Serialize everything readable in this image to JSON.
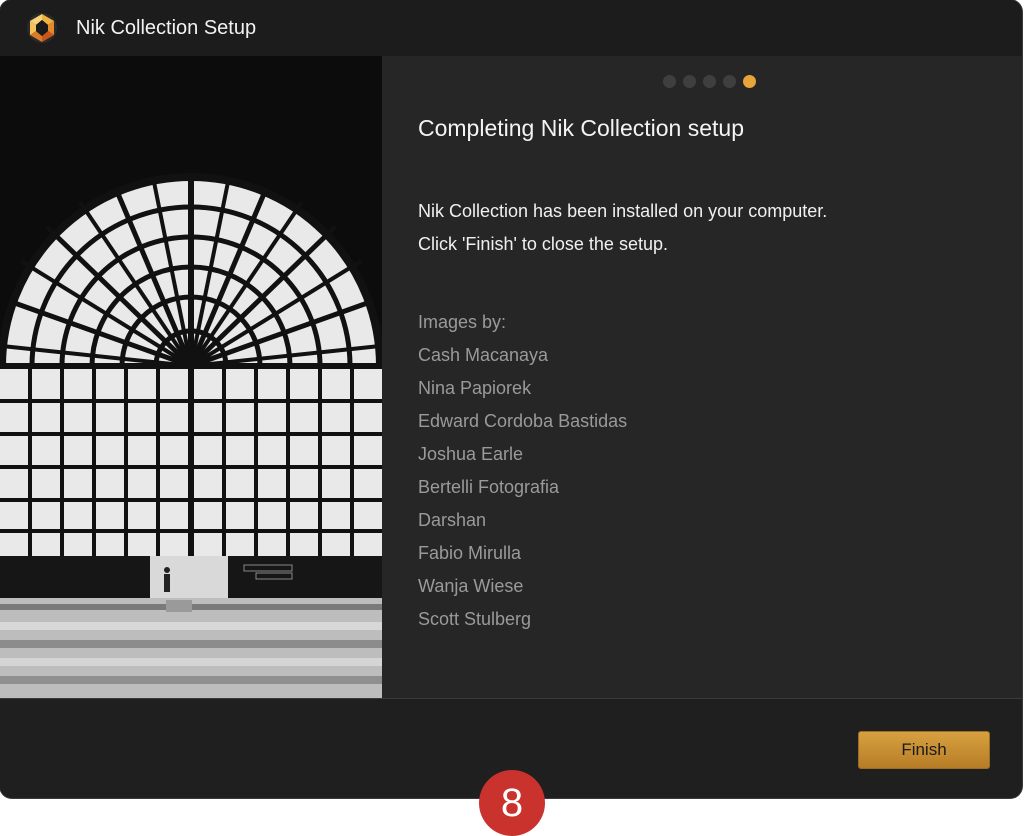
{
  "window": {
    "title": "Nik Collection Setup"
  },
  "steps": {
    "total": 5,
    "current": 5
  },
  "content": {
    "heading": "Completing Nik Collection setup",
    "message_line1": "Nik Collection has been installed on your computer.",
    "message_line2": "Click 'Finish' to close the setup.",
    "credits_label": "Images by:",
    "credits": [
      "Cash Macanaya",
      "Nina Papiorek",
      "Edward Cordoba Bastidas",
      "Joshua Earle",
      "Bertelli Fotografia",
      "Darshan",
      "Fabio Mirulla",
      "Wanja Wiese",
      "Scott Stulberg"
    ]
  },
  "footer": {
    "finish_label": "Finish"
  },
  "annotation": {
    "badge": "8"
  },
  "colors": {
    "accent": "#e8a33a",
    "window_bg": "#1f1f20",
    "panel_bg": "#262627",
    "badge": "#c9322d"
  }
}
